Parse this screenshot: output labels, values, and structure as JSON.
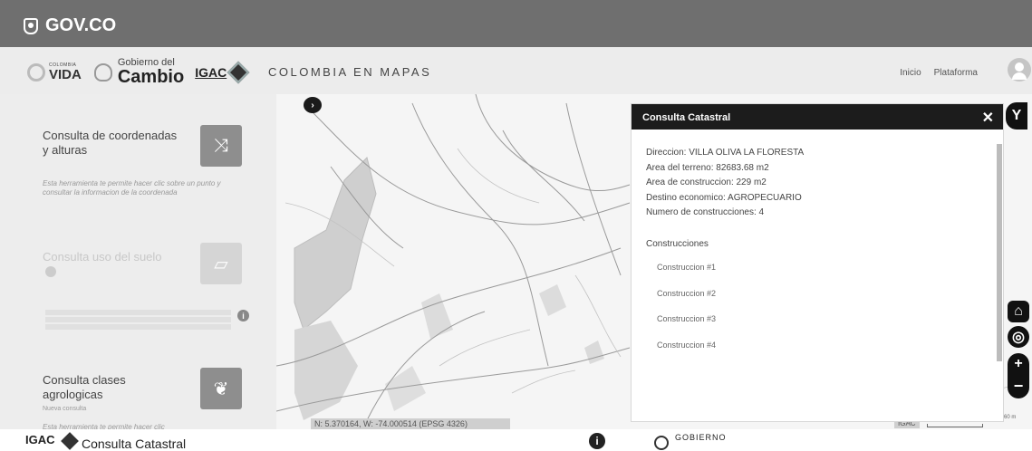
{
  "govbar": {
    "logo_text": "GOV.CO"
  },
  "header": {
    "brand": {
      "colombia_small": "COLOMBIA",
      "vida": "VIDA",
      "gobierno_del": "Gobierno del",
      "cambio": "Cambio",
      "igac": "IGAC"
    },
    "site_title": "COLOMBIA EN MAPAS",
    "nav": [
      "Inicio",
      "Plataforma"
    ]
  },
  "sidebar": {
    "cards": [
      {
        "title": "Consulta de coordenadas y alturas",
        "description": "Esta herramienta te permite hacer clic sobre un punto y consultar la informacion de la coordenada",
        "icon": "shuffle-icon"
      },
      {
        "title": "Consulta uso del suelo",
        "description": "",
        "icon": "map-icon"
      },
      {
        "title": "Consulta clases agrologicas",
        "subtitle": "Nueva consulta",
        "description": "Esta herramienta te permite hacer clic",
        "icon": "leaf-icon"
      }
    ]
  },
  "map": {
    "coordinates": "N: 5.370164, W: -74.000514 (EPSG 4326)",
    "attribution": "IGAC",
    "scale_label": "60 m"
  },
  "popup": {
    "title": "Consulta Catastral",
    "fields": [
      "Direccion: VILLA OLIVA LA FLORESTA",
      "Area del terreno: 82683.68 m2",
      "Area de construccion: 229 m2",
      "Destino economico: AGROPECUARIO",
      "Numero de construcciones: 4"
    ],
    "section_title": "Construcciones",
    "constructions": [
      "Construccion #1",
      "Construccion #2",
      "Construccion #3",
      "Construccion #4"
    ]
  },
  "footer": {
    "logo": "IGAC",
    "title": "Consulta Catastral",
    "gobierno": "GOBIERNO"
  }
}
